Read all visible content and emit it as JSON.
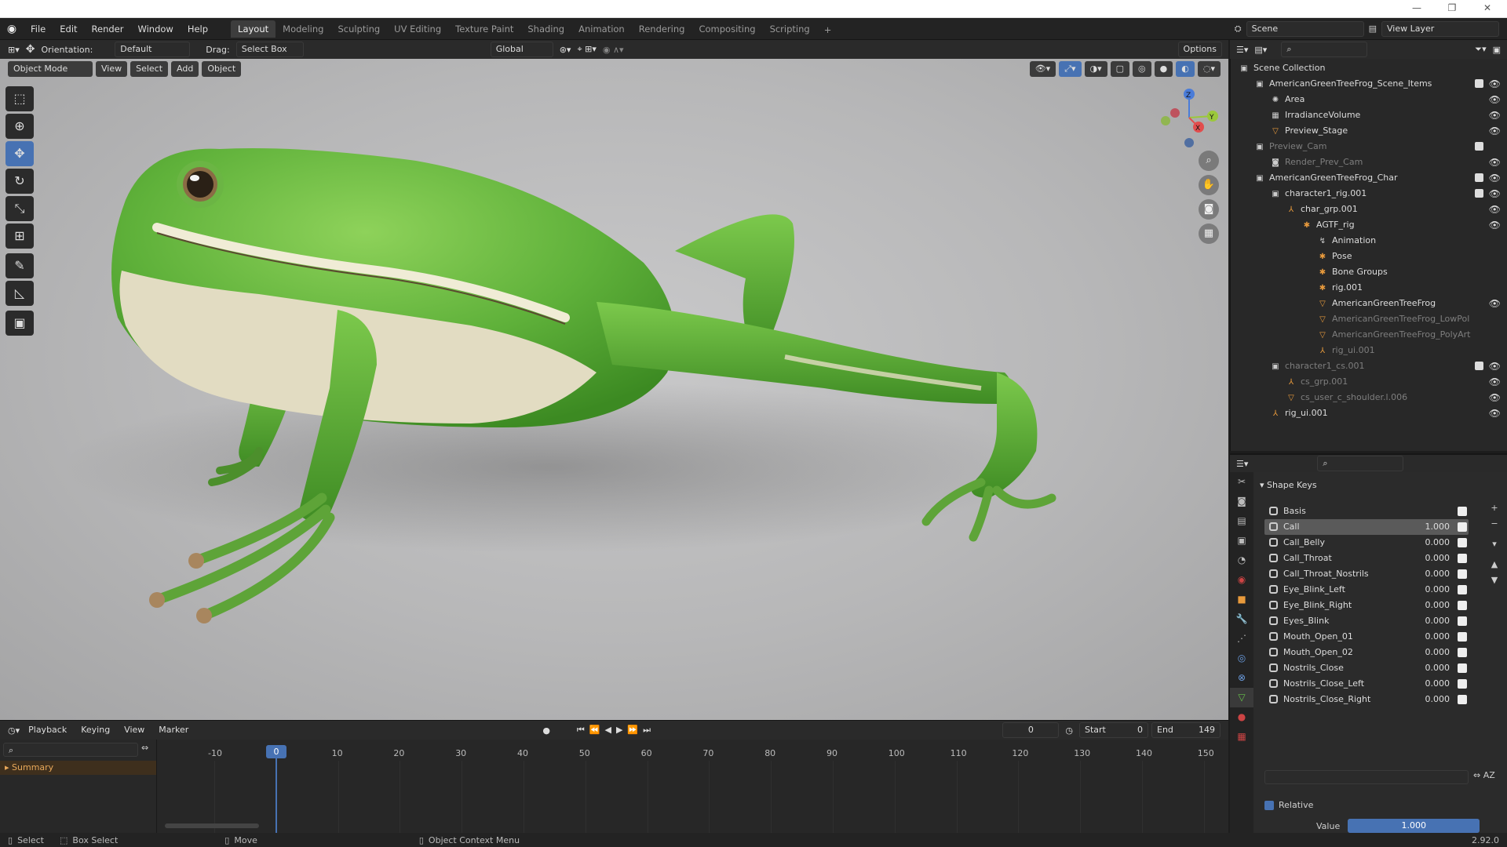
{
  "window_controls": {
    "minimize": "—",
    "maximize": "❐",
    "close": "✕"
  },
  "menu": [
    "File",
    "Edit",
    "Render",
    "Window",
    "Help"
  ],
  "workspaces": [
    "Layout",
    "Modeling",
    "Sculpting",
    "UV Editing",
    "Texture Paint",
    "Shading",
    "Animation",
    "Rendering",
    "Compositing",
    "Scripting"
  ],
  "scene": {
    "label": "Scene",
    "view_layer": "View Layer"
  },
  "header": {
    "orientation_label": "Orientation:",
    "orientation_value": "Default",
    "drag_label": "Drag:",
    "drag_value": "Select Box",
    "transform_orientation": "Global",
    "options": "Options"
  },
  "viewport_header": {
    "mode": "Object Mode",
    "view": "View",
    "select": "Select",
    "add": "Add",
    "object": "Object"
  },
  "gizmo": {
    "x": "X",
    "y": "Y",
    "z": "Z"
  },
  "outliner": {
    "rows": [
      {
        "label": "Scene Collection",
        "indent": 0,
        "icon": "▣",
        "eye": false,
        "check": false,
        "dim": false
      },
      {
        "label": "AmericanGreenTreeFrog_Scene_Items",
        "indent": 1,
        "icon": "▣",
        "eye": true,
        "check": true,
        "dim": false
      },
      {
        "label": "Area",
        "indent": 2,
        "icon": "✺",
        "eye": true,
        "check": false,
        "dim": false
      },
      {
        "label": "IrradianceVolume",
        "indent": 2,
        "icon": "▦",
        "eye": true,
        "check": false,
        "dim": false
      },
      {
        "label": "Preview_Stage",
        "indent": 2,
        "icon": "▽",
        "eye": true,
        "check": false,
        "dim": false
      },
      {
        "label": "Preview_Cam",
        "indent": 1,
        "icon": "▣",
        "eye": false,
        "check": true,
        "dim": true
      },
      {
        "label": "Render_Prev_Cam",
        "indent": 2,
        "icon": "◙",
        "eye": true,
        "check": false,
        "dim": true
      },
      {
        "label": "AmericanGreenTreeFrog_Char",
        "indent": 1,
        "icon": "▣",
        "eye": true,
        "check": true,
        "dim": false
      },
      {
        "label": "character1_rig.001",
        "indent": 2,
        "icon": "▣",
        "eye": true,
        "check": true,
        "dim": false
      },
      {
        "label": "char_grp.001",
        "indent": 3,
        "icon": "⅄",
        "eye": true,
        "check": false,
        "dim": false
      },
      {
        "label": "AGTF_rig",
        "indent": 4,
        "icon": "✱",
        "eye": true,
        "check": false,
        "dim": false
      },
      {
        "label": "Animation",
        "indent": 5,
        "icon": "↯",
        "eye": false,
        "check": false,
        "dim": false
      },
      {
        "label": "Pose",
        "indent": 5,
        "icon": "✱",
        "eye": false,
        "check": false,
        "dim": false
      },
      {
        "label": "Bone Groups",
        "indent": 5,
        "icon": "✱",
        "eye": false,
        "check": false,
        "dim": false
      },
      {
        "label": "rig.001",
        "indent": 5,
        "icon": "✱",
        "eye": false,
        "check": false,
        "dim": false
      },
      {
        "label": "AmericanGreenTreeFrog",
        "indent": 5,
        "icon": "▽",
        "eye": true,
        "check": false,
        "dim": false
      },
      {
        "label": "AmericanGreenTreeFrog_LowPol",
        "indent": 5,
        "icon": "▽",
        "eye": false,
        "check": false,
        "dim": true
      },
      {
        "label": "AmericanGreenTreeFrog_PolyArt",
        "indent": 5,
        "icon": "▽",
        "eye": false,
        "check": false,
        "dim": true
      },
      {
        "label": "rig_ui.001",
        "indent": 5,
        "icon": "⅄",
        "eye": false,
        "check": false,
        "dim": true
      },
      {
        "label": "character1_cs.001",
        "indent": 2,
        "icon": "▣",
        "eye": true,
        "check": true,
        "dim": true
      },
      {
        "label": "cs_grp.001",
        "indent": 3,
        "icon": "⅄",
        "eye": true,
        "check": false,
        "dim": true
      },
      {
        "label": "cs_user_c_shoulder.l.006",
        "indent": 3,
        "icon": "▽",
        "eye": true,
        "check": false,
        "dim": true
      },
      {
        "label": "rig_ui.001",
        "indent": 2,
        "icon": "⅄",
        "eye": true,
        "check": false,
        "dim": false
      }
    ]
  },
  "properties": {
    "panel_title": "Shape Keys",
    "shape_keys": [
      {
        "name": "Basis",
        "value": ""
      },
      {
        "name": "Call",
        "value": "1.000"
      },
      {
        "name": "Call_Belly",
        "value": "0.000"
      },
      {
        "name": "Call_Throat",
        "value": "0.000"
      },
      {
        "name": "Call_Throat_Nostrils",
        "value": "0.000"
      },
      {
        "name": "Eye_Blink_Left",
        "value": "0.000"
      },
      {
        "name": "Eye_Blink_Right",
        "value": "0.000"
      },
      {
        "name": "Eyes_Blink",
        "value": "0.000"
      },
      {
        "name": "Mouth_Open_01",
        "value": "0.000"
      },
      {
        "name": "Mouth_Open_02",
        "value": "0.000"
      },
      {
        "name": "Nostrils_Close",
        "value": "0.000"
      },
      {
        "name": "Nostrils_Close_Left",
        "value": "0.000"
      },
      {
        "name": "Nostrils_Close_Right",
        "value": "0.000"
      }
    ],
    "selected_index": 1,
    "relative_label": "Relative",
    "value_label": "Value",
    "value": "1.000",
    "value_fraction": 1.0
  },
  "timeline": {
    "playback": "Playback",
    "keying": "Keying",
    "view": "View",
    "marker": "Marker",
    "current_frame": "0",
    "start_label": "Start",
    "start": "0",
    "end_label": "End",
    "end": "149",
    "ticks": [
      "-10",
      "0",
      "10",
      "20",
      "30",
      "40",
      "50",
      "60",
      "70",
      "80",
      "90",
      "100",
      "110",
      "120",
      "130",
      "140",
      "150"
    ],
    "summary": "Summary"
  },
  "statusbar": {
    "select": "Select",
    "box_select": "Box Select",
    "move": "Move",
    "context_menu": "Object Context Menu",
    "version": "2.92.0"
  },
  "colors": {
    "accent": "#4772b3",
    "frog_green": "#5fb13a",
    "frog_belly": "#e2dcc2"
  }
}
